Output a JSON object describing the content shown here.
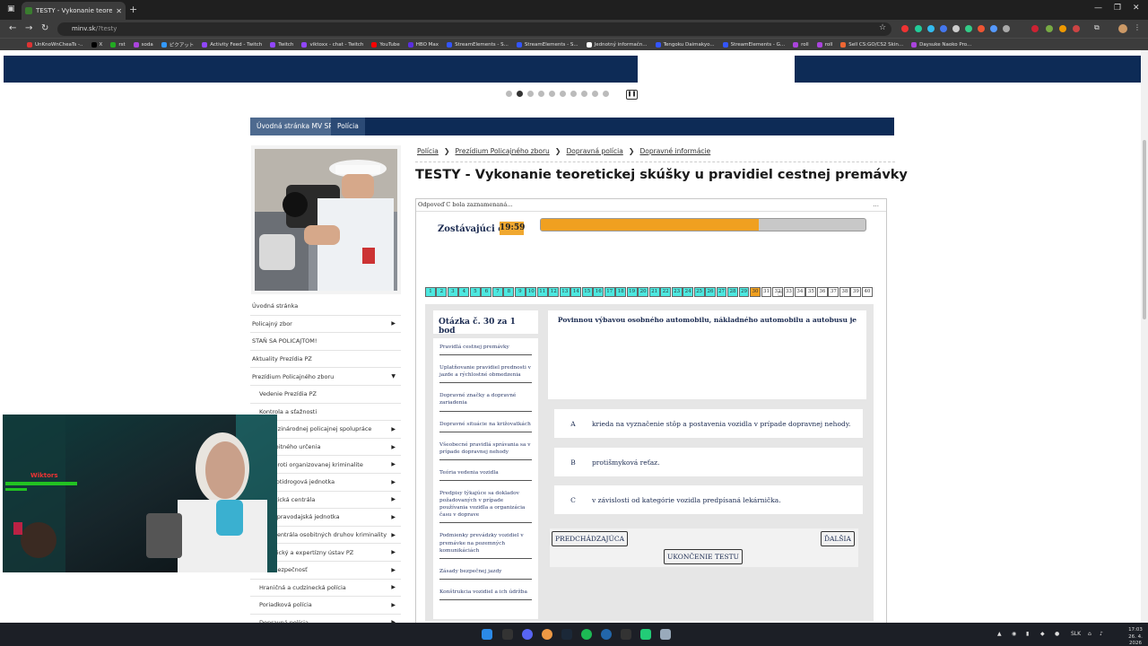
{
  "browser": {
    "tab_title": "TESTY - Vykonanie teoretickej...",
    "url_host": "minv.sk",
    "url_path": "/?testy",
    "bookmarks": [
      {
        "label": "UnKnoWnCheaTs -..",
        "color": "#d33"
      },
      {
        "label": "X",
        "color": "#000"
      },
      {
        "label": "rst",
        "color": "#2a2"
      },
      {
        "label": "soda",
        "color": "#a4d"
      },
      {
        "label": "ピクアット",
        "color": "#39f"
      },
      {
        "label": "Activity Feed - Twitch",
        "color": "#9146ff"
      },
      {
        "label": "Twitch",
        "color": "#9146ff"
      },
      {
        "label": "viktoxx - chat - Twitch",
        "color": "#9146ff"
      },
      {
        "label": "YouTube",
        "color": "#f00"
      },
      {
        "label": "HBO Max",
        "color": "#5a2ee0"
      },
      {
        "label": "StreamElements - S...",
        "color": "#35f"
      },
      {
        "label": "StreamElements - S...",
        "color": "#35f"
      },
      {
        "label": "Jednotný informačn...",
        "color": "#fff"
      },
      {
        "label": "Tengoku Daimakyo...",
        "color": "#35f"
      },
      {
        "label": "StreamElements - G...",
        "color": "#35f"
      },
      {
        "label": "roll",
        "color": "#a4d"
      },
      {
        "label": "roll",
        "color": "#a4d"
      },
      {
        "label": "Sell CS:GO/CS2 Skin...",
        "color": "#e63"
      },
      {
        "label": "Daysuke Naoko Pro...",
        "color": "#a4d"
      }
    ]
  },
  "topnav": {
    "item1": "Úvodná stránka MV SR",
    "item2": "Polícia"
  },
  "sidemenu": [
    {
      "label": "Úvodná stránka",
      "arrow": "",
      "sub": false
    },
    {
      "label": "Policajný zbor",
      "arrow": "▶",
      "sub": false
    },
    {
      "label": "STAŇ SA POLICAJTOM!",
      "arrow": "",
      "sub": false
    },
    {
      "label": "Aktuality Prezídia PZ",
      "arrow": "",
      "sub": false
    },
    {
      "label": "Prezídium Policajného zboru",
      "arrow": "▼",
      "sub": false
    },
    {
      "label": "Vedenie Prezídia PZ",
      "arrow": "",
      "sub": true
    },
    {
      "label": "Kontrola a sťažnosti",
      "arrow": "",
      "sub": true
    },
    {
      "label": "...medzinárodnej policajnej spolupráce",
      "arrow": "▶",
      "sub": true
    },
    {
      "label": "...osobitného určenia",
      "arrow": "▶",
      "sub": true
    },
    {
      "label": "...ba proti organizovanej kriminalite",
      "arrow": "▶",
      "sub": true
    },
    {
      "label": "...á protidrogová jednotka",
      "arrow": "▶",
      "sub": true
    },
    {
      "label": "...oristická centrála",
      "arrow": "▶",
      "sub": true
    },
    {
      "label": "...ná spravodajská jednotka",
      "arrow": "▶",
      "sub": true
    },
    {
      "label": "...ná centrála osobitných druhov kriminality",
      "arrow": "▶",
      "sub": true
    },
    {
      "label": "...alistický a expertízny ústav PZ",
      "arrow": "▶",
      "sub": true
    },
    {
      "label": "...ná bezpečnosť",
      "arrow": "▶",
      "sub": true
    },
    {
      "label": "Hraničná a cudzinecká polícia",
      "arrow": "▶",
      "sub": true
    },
    {
      "label": "Poriadková polícia",
      "arrow": "▶",
      "sub": true
    },
    {
      "label": "Dopravná polícia",
      "arrow": "▶",
      "sub": true
    }
  ],
  "breadcrumb": [
    "Polícia",
    "Prezídium Policajného zboru",
    "Dopravná polícia",
    "Dopravné informácie"
  ],
  "page_title": "TESTY - Vykonanie teoretickej skúšky u pravidiel cestnej premávky",
  "test": {
    "status": "Odpoveď C bola zaznamenaná...",
    "status_more": "...",
    "time_label": "Zostávajúci čas",
    "time_value": "19:59",
    "progress": 0.67,
    "question_count": 40,
    "answered_through": 29,
    "current_question": 30,
    "question_header": "Otázka č. 30 za 1 bod",
    "categories": [
      "Pravidlá cestnej premávky",
      "Uplatňovanie pravidiel prednosti v jazde a rýchlostné obmedzenia",
      "Dopravné značky a dopravné zariadenia",
      "Dopravné situácie na križovatkách",
      "Všeobecné pravidlá správania sa v prípade dopravnej nehody",
      "Teória vedenia vozidla",
      "Predpisy týkajúce sa dokladov požadovaných v prípade používania vozidla a organizácia času v doprave",
      "Podmienky prevádzky vozidiel v premávke na pozemných komunikáciách",
      "Zásady bezpečnej jazdy",
      "Konštrukcia vozidiel a ich údržba"
    ],
    "question_text": "Povinnou výbavou osobného automobilu, nákladného automobilu a autobusu je",
    "answers": [
      {
        "letter": "A",
        "text": "krieda na vyznačenie stôp a postavenia vozidla v prípade dopravnej nehody."
      },
      {
        "letter": "B",
        "text": "protišmyková reťaz."
      },
      {
        "letter": "C",
        "text": "v závislosti od kategórie vozidla predpísaná lekárnička."
      }
    ],
    "btn_prev": "PREDCHÁDZAJÚCA",
    "btn_next": "ĎALŠIA",
    "btn_end": "UKONČENIE TESTU"
  },
  "webcam": {
    "overlay_name": "Wiktors"
  },
  "taskbar": {
    "lang": "SLK",
    "time": "17:03",
    "date": "26. 4. 2026"
  },
  "colors": {
    "navy": "#0d2b56",
    "answered": "#4de8e0",
    "current": "#f0a020",
    "timer": "#f0a830"
  }
}
